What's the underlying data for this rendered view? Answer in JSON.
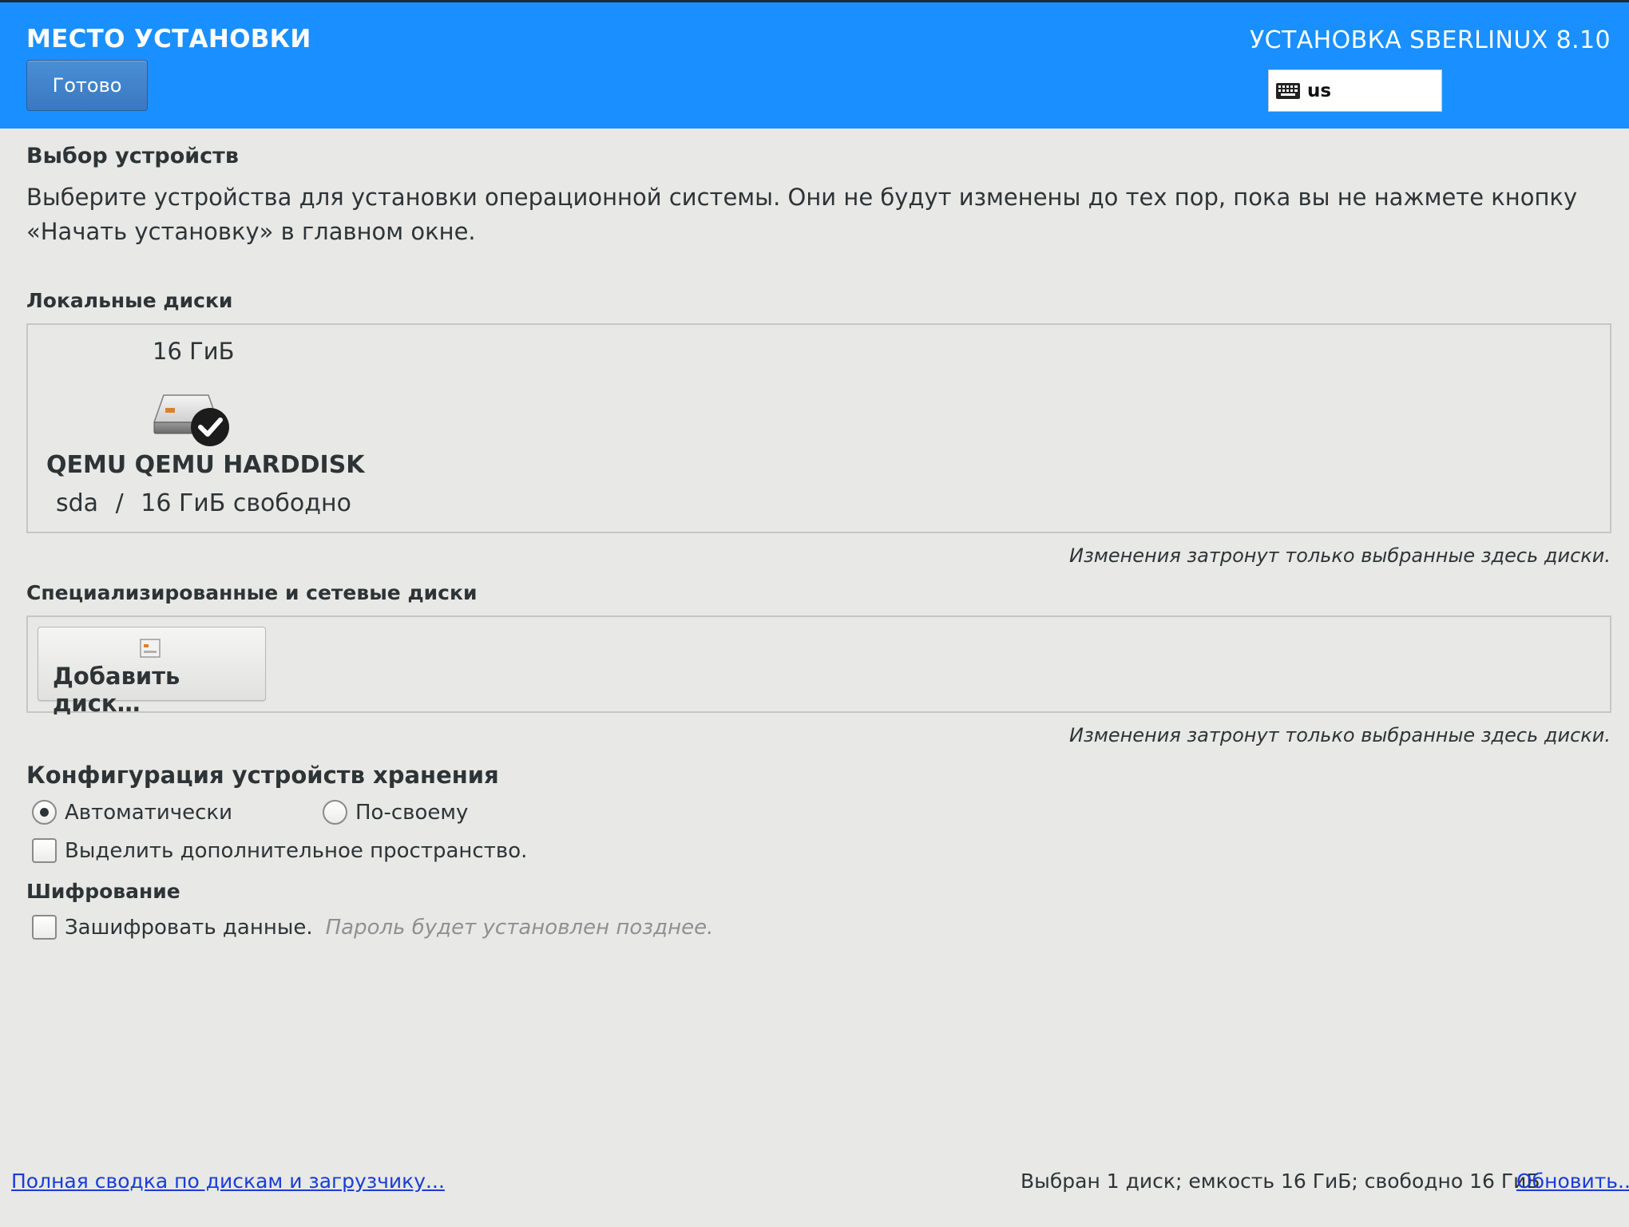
{
  "header": {
    "spoke_title": "МЕСТО УСТАНОВКИ",
    "done_label": "Готово",
    "product_title": "УСТАНОВКА SBERLINUX 8.10",
    "keyboard_layout": "us"
  },
  "device_selection": {
    "title": "Выбор устройств",
    "description": "Выберите устройства для установки операционной системы. Они не будут изменены до тех пор, пока вы не нажмете кнопку «Начать установку» в главном окне."
  },
  "local_disks": {
    "title": "Локальные диски",
    "disks": [
      {
        "size": "16 ГиБ",
        "name": "QEMU QEMU HARDDISK",
        "device": "sda",
        "separator": "/",
        "free": "16 ГиБ свободно",
        "selected": true
      }
    ],
    "hint": "Изменения затронут только выбранные здесь диски."
  },
  "specialized_disks": {
    "title": "Специализированные и сетевые диски",
    "add_disk_label": "Добавить диск…",
    "hint": "Изменения затронут только выбранные здесь диски."
  },
  "storage_config": {
    "title": "Конфигурация устройств хранения",
    "auto_label": "Автоматически",
    "custom_label": "По-своему",
    "selected": "auto",
    "reclaim_label": "Выделить дополнительное пространство."
  },
  "encryption": {
    "title": "Шифрование",
    "encrypt_label": "Зашифровать данные.",
    "encrypt_hint": "Пароль будет установлен позднее."
  },
  "footer": {
    "summary_link": "Полная сводка по дискам и загрузчику...",
    "status_text": "Выбран 1 диск; емкость 16 ГиБ; свободно 16 ГиБ",
    "refresh_link": "Обновить..."
  },
  "colors": {
    "header_bg": "#1a8fff",
    "body_bg": "#e8e8e7",
    "link": "#1a3cd8"
  }
}
